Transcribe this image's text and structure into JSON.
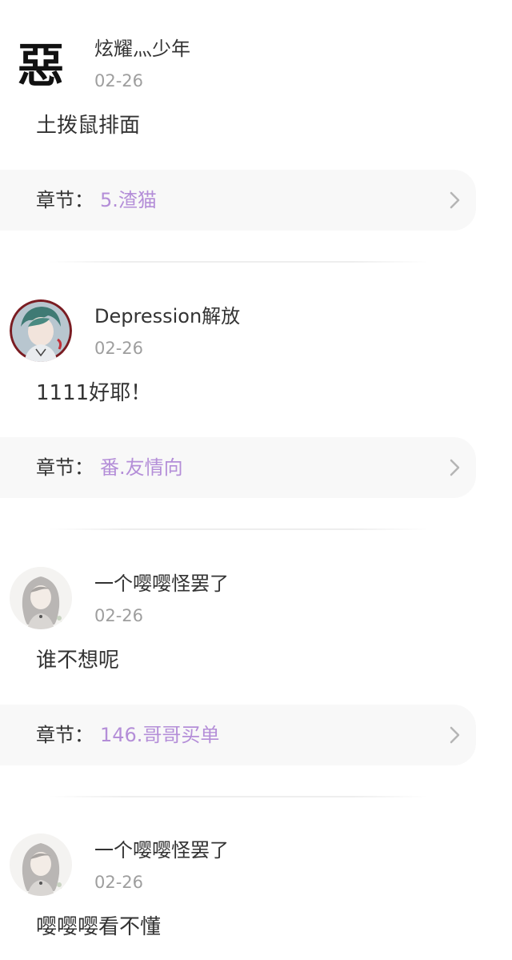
{
  "comments": [
    {
      "username": "炫耀灬少年",
      "date": "02-26",
      "text": "土拨鼠排面",
      "chapter_label": "章节：",
      "chapter_name": "5.渣猫",
      "avatar_glyph": "惡"
    },
    {
      "username": "Depression解放",
      "date": "02-26",
      "text": "1111好耶！",
      "chapter_label": "章节：",
      "chapter_name": "番.友情向"
    },
    {
      "username": "一个嘤嘤怪罢了",
      "date": "02-26",
      "text": "谁不想呢",
      "chapter_label": "章节：",
      "chapter_name": "146.哥哥买单"
    },
    {
      "username": "一个嘤嘤怪罢了",
      "date": "02-26",
      "text": "嘤嘤嘤看不懂"
    }
  ],
  "icons": {
    "chevron": "chevron-right-icon"
  },
  "colors": {
    "accent": "#b48ed8",
    "muted": "#9e9e9e",
    "text": "#333333",
    "card": "#f8f8f8"
  }
}
